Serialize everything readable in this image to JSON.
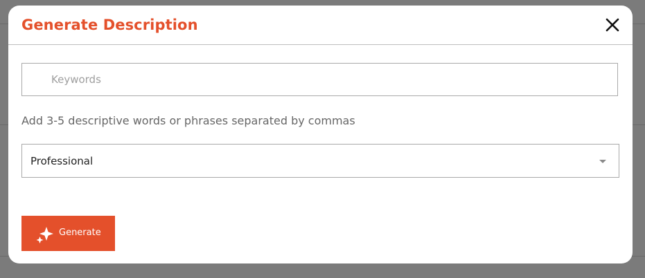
{
  "colors": {
    "accent": "#e4502b",
    "backdrop": "#7b7b7b",
    "border": "#a9a9a9"
  },
  "modal": {
    "title": "Generate Description",
    "close_icon": "close-icon"
  },
  "keywords": {
    "placeholder": "Keywords",
    "value": ""
  },
  "helper_text": "Add 3-5 descriptive words or phrases separated by commas",
  "tone_select": {
    "selected": "Professional",
    "caret_icon": "caret-down-icon"
  },
  "generate_button": {
    "label": "Generate",
    "icon": "sparkle-icon"
  }
}
